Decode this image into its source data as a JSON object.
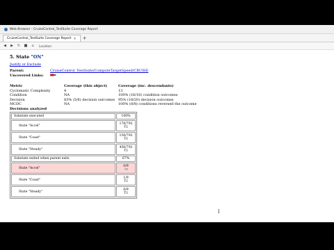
{
  "window": {
    "title": "Web Browser - CruiseControl_TestSuite Coverage Report"
  },
  "tab": {
    "label": "CruiseControl_TestSuite Coverage Report",
    "close": "×",
    "new": "+"
  },
  "nav": {
    "back": "◀",
    "forward": "▶",
    "reload": "↻",
    "stop": "■",
    "home": "⌂",
    "location_label": "Location:"
  },
  "page": {
    "heading_prefix": "5. State ",
    "heading_name": "\"ON\"",
    "justify_link": "Justify or Exclude",
    "parent_label": "Parent:",
    "parent_link": "CruiseControl_TestSuite/ComputeTargetSpeed/CRUISE",
    "uncovered_label": "Uncovered Links:",
    "metrics_header": [
      "Metric",
      "Coverage (this object)",
      "Coverage (inc. descendants)"
    ],
    "metrics": [
      [
        "Cyclomatic Complexity",
        "4",
        "13"
      ],
      [
        "Condition",
        "NA",
        "100% (16/16) condition outcomes"
      ],
      [
        "Decision",
        "83% (5/6) decision outcomes",
        "95% (18/20) decision outcomes"
      ],
      [
        "MCDC",
        "NA",
        "100% (8/8) conditions reversed the outcome"
      ]
    ],
    "decisions_title": "Decisions analyzed",
    "decisions": [
      {
        "label": "Substate executed",
        "value": "100%",
        "sub": ""
      },
      {
        "label": "State \"Accel\"",
        "value": "178/792",
        "sub": "T1"
      },
      {
        "label": "State \"Coast\"",
        "value": "158/792",
        "sub": "T1"
      },
      {
        "label": "State \"Steady\"",
        "value": "456/792",
        "sub": "T1"
      },
      {
        "label": "Substate exited when parent exits",
        "value": "67%",
        "sub": ""
      },
      {
        "label": "State \"Accel\"",
        "value": "0/9",
        "sub": ""
      },
      {
        "label": "State \"Coast\"",
        "value": "1/9",
        "sub": "T1"
      },
      {
        "label": "State \"Steady\"",
        "value": "8/9",
        "sub": "T1"
      }
    ]
  }
}
